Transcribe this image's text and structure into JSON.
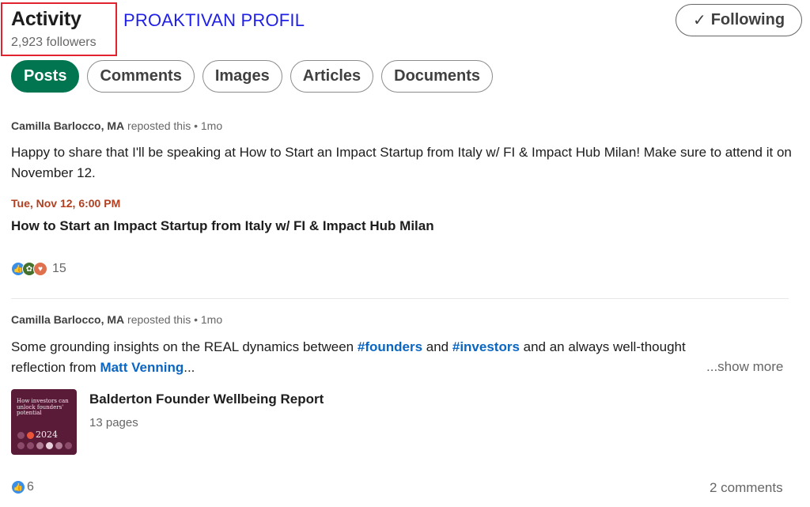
{
  "header": {
    "title": "Activity",
    "followers": "2,923 followers",
    "promo_text": "PROAKTIVAN PROFIL",
    "following_label": "Following",
    "following_icon": "check-icon"
  },
  "tabs": [
    {
      "label": "Posts",
      "active": true
    },
    {
      "label": "Comments",
      "active": false
    },
    {
      "label": "Images",
      "active": false
    },
    {
      "label": "Articles",
      "active": false
    },
    {
      "label": "Documents",
      "active": false
    }
  ],
  "posts": [
    {
      "author": "Camilla Barlocco, MA",
      "action": "reposted this",
      "time": "• 1mo",
      "text": "Happy to share that I'll be speaking at How to Start an Impact Startup from Italy w/ FI & Impact Hub Milan! Make sure to attend it on November 12.",
      "event": {
        "date": "Tue, Nov 12, 6:00 PM",
        "title": "How to Start an Impact Startup from Italy w/ FI & Impact Hub Milan"
      },
      "reaction_count": "15"
    },
    {
      "author": "Camilla Barlocco, MA",
      "action": "reposted this",
      "time": "• 1mo",
      "text_before": "Some grounding insights on the REAL dynamics between ",
      "hashtag1": "#founders",
      "text_mid": " and ",
      "hashtag2": "#investors",
      "text_after": " and an always well-thought reflection from ",
      "mention": "Matt Venning",
      "ellipsis": "...",
      "show_more": "...show more",
      "document": {
        "title": "Balderton Founder Wellbeing Report",
        "pages": "13 pages",
        "thumb_title": "How investors can unlock founders' potential",
        "thumb_year": "2024"
      },
      "reaction_count": "6",
      "comments": "2 comments"
    }
  ],
  "colors": {
    "accent_green": "#01754f",
    "link_blue": "#0a66c2",
    "event_date": "#b24020",
    "highlight_box": "#e0232e",
    "promo_blue": "#1f1fe6"
  }
}
